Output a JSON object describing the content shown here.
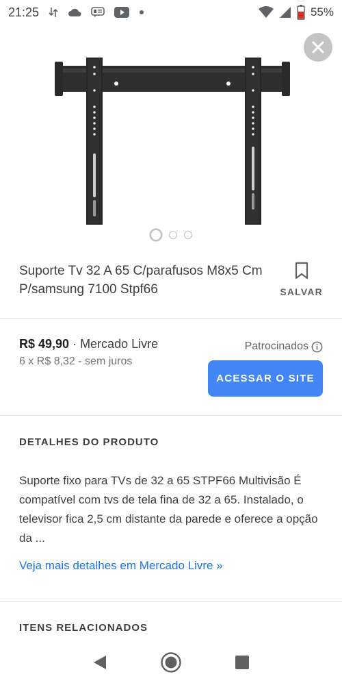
{
  "status_bar": {
    "time": "21:25",
    "battery": "55%",
    "icons": [
      "data-sync-icon",
      "cloud-icon",
      "message-icon",
      "youtube-icon",
      "notification-dot-icon",
      "wifi-icon",
      "signal-icon",
      "battery-icon"
    ]
  },
  "image_viewer": {
    "close_icon": "close-icon",
    "image": "wall-mount-bracket-image",
    "pages": 3,
    "current_page": 1
  },
  "product": {
    "title": "Suporte Tv 32 A 65 C/parafusos M8x5 Cm P/samsung 7100 Stpf66",
    "save_label": "SALVAR"
  },
  "offer": {
    "price": "R$ 49,90",
    "separator": " · ",
    "seller": "Mercado Livre",
    "installments": "6 x R$ 8,32 - sem juros",
    "sponsored": "Patrocinados",
    "visit_button": "ACESSAR O SITE"
  },
  "details": {
    "heading": "DETALHES DO PRODUTO",
    "description": "Suporte fixo para TVs de 32 a 65 STPF66 Multivisão É compatível com tvs de tela fina de 32 a 65. Instalado, o televisor fica 2,5 cm distante da parede e oferece a opção da ...",
    "more_link": "Veja mais detalhes em Mercado Livre »"
  },
  "related": {
    "heading": "ITENS RELACIONADOS"
  },
  "nav_bar": {
    "icons": [
      "back-icon",
      "home-icon",
      "recents-icon"
    ]
  },
  "colors": {
    "accent": "#4285f4",
    "link": "#1a73e8",
    "text": "#3c4043",
    "muted": "#70757a"
  }
}
